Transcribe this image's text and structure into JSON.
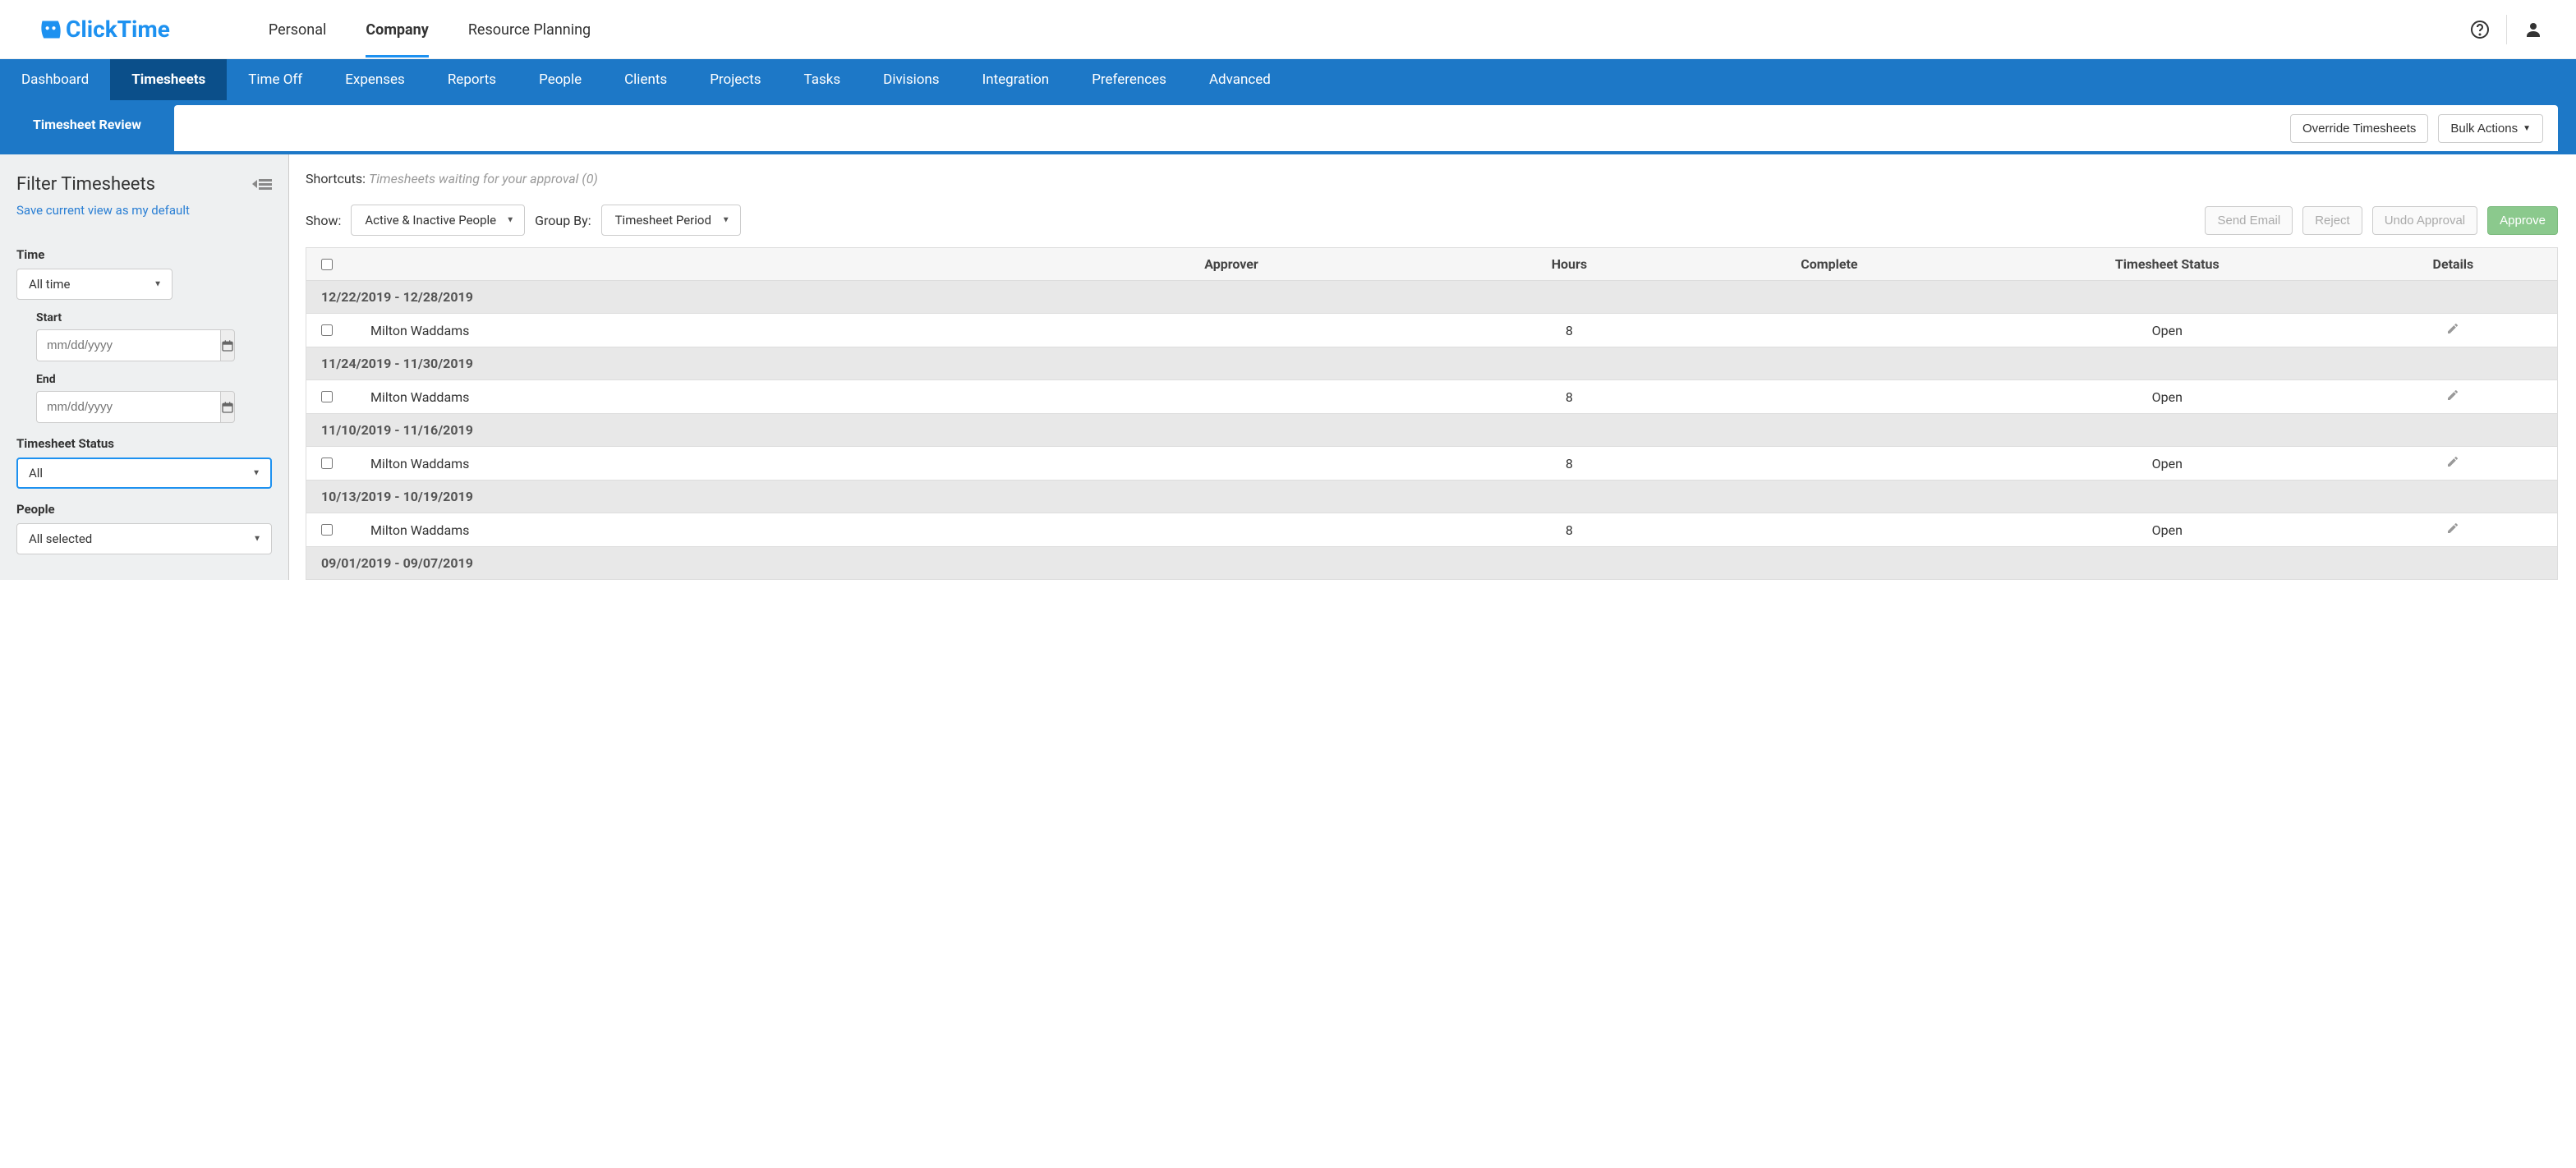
{
  "brand": "ClickTime",
  "topnav": {
    "items": [
      "Personal",
      "Company",
      "Resource Planning"
    ],
    "selected_index": 1
  },
  "bluenav": {
    "items": [
      "Dashboard",
      "Timesheets",
      "Time Off",
      "Expenses",
      "Reports",
      "People",
      "Clients",
      "Projects",
      "Tasks",
      "Divisions",
      "Integration",
      "Preferences",
      "Advanced"
    ],
    "selected_index": 1
  },
  "subtab": "Timesheet Review",
  "actions": {
    "override": "Override Timesheets",
    "bulk": "Bulk Actions"
  },
  "sidebar": {
    "title": "Filter Timesheets",
    "save_link": "Save current view as my default",
    "time_label": "Time",
    "time_value": "All time",
    "start_label": "Start",
    "end_label": "End",
    "date_placeholder": "mm/dd/yyyy",
    "status_label": "Timesheet Status",
    "status_value": "All",
    "people_label": "People",
    "people_value": "All selected"
  },
  "main": {
    "shortcuts_label": "Shortcuts:",
    "shortcuts_value": "Timesheets waiting for your approval (0)",
    "show_label": "Show:",
    "show_value": "Active & Inactive People",
    "group_label": "Group By:",
    "group_value": "Timesheet Period",
    "btn_send": "Send Email",
    "btn_reject": "Reject",
    "btn_undo": "Undo Approval",
    "btn_approve": "Approve"
  },
  "table": {
    "headers": {
      "approver": "Approver",
      "hours": "Hours",
      "complete": "Complete",
      "status": "Timesheet Status",
      "details": "Details"
    },
    "groups": [
      {
        "label": "12/22/2019 - 12/28/2019",
        "rows": [
          {
            "name": "Milton Waddams",
            "hours": "8",
            "status": "Open"
          }
        ]
      },
      {
        "label": "11/24/2019 - 11/30/2019",
        "rows": [
          {
            "name": "Milton Waddams",
            "hours": "8",
            "status": "Open"
          }
        ]
      },
      {
        "label": "11/10/2019 - 11/16/2019",
        "rows": [
          {
            "name": "Milton Waddams",
            "hours": "8",
            "status": "Open"
          }
        ]
      },
      {
        "label": "10/13/2019 - 10/19/2019",
        "rows": [
          {
            "name": "Milton Waddams",
            "hours": "8",
            "status": "Open"
          }
        ]
      },
      {
        "label": "09/01/2019 - 09/07/2019",
        "rows": []
      }
    ]
  }
}
